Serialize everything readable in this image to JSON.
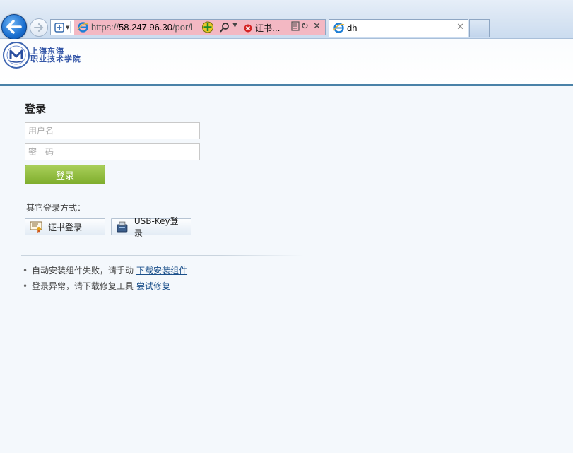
{
  "browser": {
    "url_scheme": "https://",
    "url_host": "58.247.96.30",
    "url_path": "/por/l",
    "cert_error_label": "证书...",
    "tab_title": "dh",
    "tab_close": "✕",
    "refresh": "↻",
    "stop": "✕"
  },
  "header": {
    "logo_line1": "上海东海",
    "logo_line2": "职业技术学院"
  },
  "login": {
    "title": "登录",
    "username_placeholder": "用户名",
    "password_placeholder": "密　码",
    "submit_label": "登录",
    "other_methods_label": "其它登录方式：",
    "cert_login_label": "证书登录",
    "usbkey_login_label": "USB-Key登录"
  },
  "help": {
    "line1_text": "自动安装组件失败，请手动",
    "line1_link": "下载安装组件",
    "line2_text": "登录异常，请下载修复工具",
    "line2_link": "尝试修复"
  },
  "colors": {
    "page_bg": "#f4f8fc",
    "login_button": "#8ebd3a",
    "link": "#1a4f8a",
    "header_rule": "#4a82a8"
  }
}
